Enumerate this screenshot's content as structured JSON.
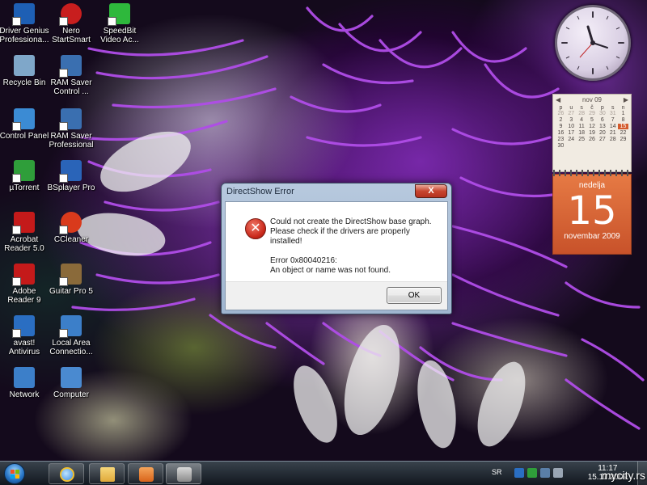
{
  "desktop": {
    "icons": [
      {
        "label": "Driver Genius Professiona...",
        "icon": "driver-genius-icon",
        "color": "#1e5fb4"
      },
      {
        "label": "Nero StartSmart",
        "icon": "nero-icon",
        "color": "#c81e1e"
      },
      {
        "label": "SpeedBit Video Ac...",
        "icon": "speedbit-icon",
        "color": "#2eb83c"
      },
      {
        "label": "Recycle Bin",
        "icon": "recycle-bin-icon",
        "color": "#7fa7c9"
      },
      {
        "label": "RAM Saver Control ...",
        "icon": "ram-saver-icon",
        "color": "#3a6fb0"
      },
      {
        "label": "Control Panel",
        "icon": "control-panel-icon",
        "color": "#3b8bd4"
      },
      {
        "label": "RAM Saver Professional",
        "icon": "ram-saver-pro-icon",
        "color": "#3a6fb0"
      },
      {
        "label": "µTorrent",
        "icon": "utorrent-icon",
        "color": "#2f9e3a"
      },
      {
        "label": "BSplayer Pro",
        "icon": "bsplayer-icon",
        "color": "#2a64b8"
      },
      {
        "label": "Acrobat Reader 5.0",
        "icon": "acrobat-icon",
        "color": "#c41a1a"
      },
      {
        "label": "CCleaner",
        "icon": "ccleaner-icon",
        "color": "#d93a1c"
      },
      {
        "label": "Adobe Reader 9",
        "icon": "adobe-reader-icon",
        "color": "#c41a1a"
      },
      {
        "label": "Guitar Pro 5",
        "icon": "guitar-pro-icon",
        "color": "#8a6a3a"
      },
      {
        "label": "avast! Antivirus",
        "icon": "avast-icon",
        "color": "#2a6ec2"
      },
      {
        "label": "Local Area Connectio...",
        "icon": "network-connection-icon",
        "color": "#3c7fc9"
      },
      {
        "label": "Network",
        "icon": "network-icon",
        "color": "#3c7fc9"
      },
      {
        "label": "Computer",
        "icon": "computer-icon",
        "color": "#4a8ad0"
      }
    ]
  },
  "calendar": {
    "month_header": "nov 09",
    "weekday_headers": [
      "p",
      "u",
      "s",
      "č",
      "p",
      "s",
      "n"
    ],
    "days": [
      "26",
      "27",
      "28",
      "29",
      "30",
      "31",
      "1",
      "2",
      "3",
      "4",
      "5",
      "6",
      "7",
      "8",
      "9",
      "10",
      "11",
      "12",
      "13",
      "14",
      "15",
      "16",
      "17",
      "18",
      "19",
      "20",
      "21",
      "22",
      "23",
      "24",
      "25",
      "26",
      "27",
      "28",
      "29",
      "30"
    ],
    "today": "15",
    "weekday": "nedelja",
    "day": "15",
    "month_year": "novembar 2009"
  },
  "dialog": {
    "title": "DirectShow Error",
    "close_label": "X",
    "line1": "Could not create the DirectShow base graph.",
    "line2": "Please check if the drivers are properly installed!",
    "line3": "Error 0x80040216:",
    "line4": "An object or name was not found.",
    "ok_label": "OK",
    "error_icon_glyph": "✕"
  },
  "taskbar": {
    "language": "SR",
    "time": "11:17",
    "date": "15.11.2009",
    "pinned": [
      {
        "name": "internet-explorer-icon",
        "color": "#3a8ae0"
      },
      {
        "name": "explorer-folder-icon",
        "color": "#e8b84a"
      },
      {
        "name": "media-player-icon",
        "color": "#e07a1a"
      },
      {
        "name": "tv-app-icon",
        "color": "#9a9a9a"
      }
    ]
  },
  "watermark": "mycity.rs"
}
